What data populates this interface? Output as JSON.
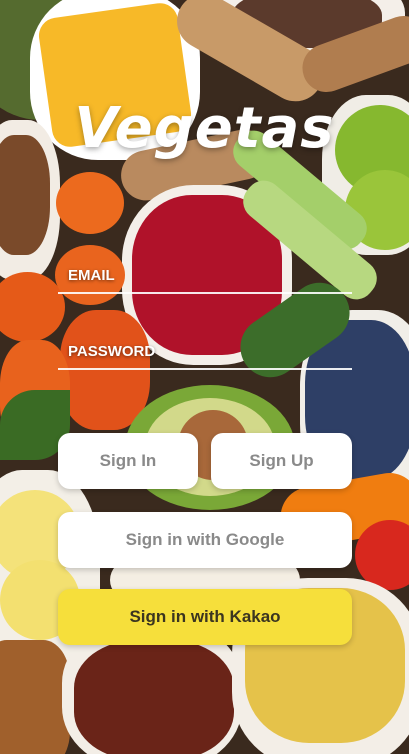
{
  "app": {
    "title": "Vegetas"
  },
  "login_form": {
    "email_label": "EMAIL",
    "password_label": "PASSWORD",
    "email_value": "",
    "password_value": ""
  },
  "buttons": {
    "sign_in": "Sign In",
    "sign_up": "Sign Up",
    "google": "Sign in with Google",
    "kakao": "Sign in with Kakao"
  },
  "colors": {
    "kakao_button": "#f6df3b",
    "button_text_gray": "#8a8a8a",
    "kakao_text": "#3b3520"
  },
  "background": {
    "description_icon": "vegetables-photo"
  }
}
